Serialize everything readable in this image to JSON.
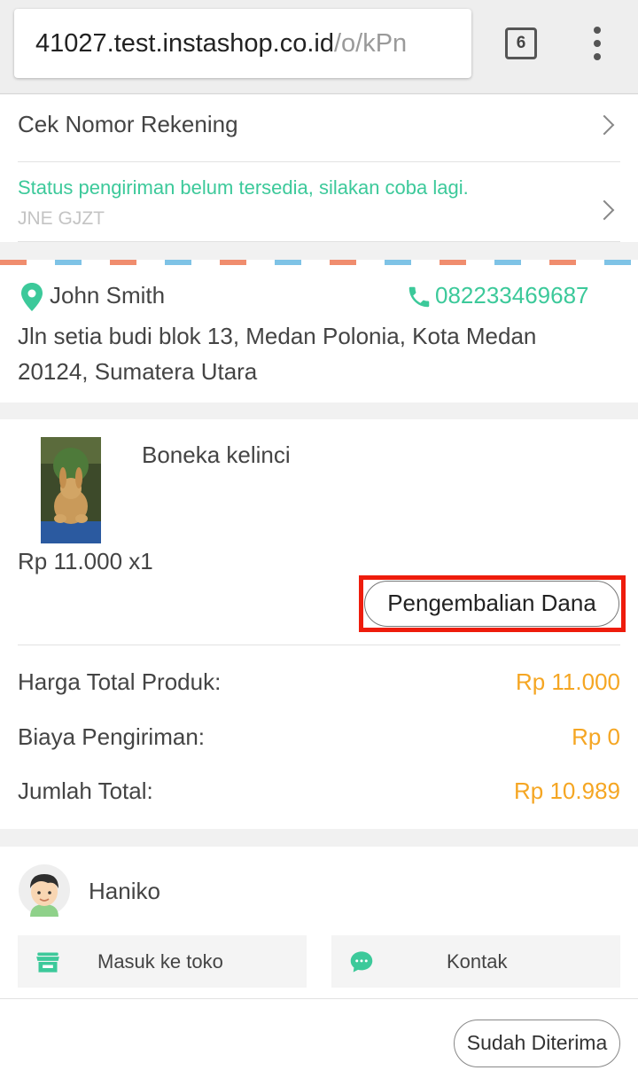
{
  "browser": {
    "url_host": "41027.test.instashop.co.id",
    "url_path": "/o/kPn",
    "tab_count": "6",
    "menu_icon": "more-vert-icon"
  },
  "order": {
    "check_account_label": "Cek Nomor Rekening",
    "shipping_status": "Status pengiriman belum tersedia, silakan coba lagi.",
    "courier": "JNE GJZT"
  },
  "recipient": {
    "name": "John Smith",
    "phone": "082233469687",
    "address": "Jln setia budi blok 13, Medan Polonia, Kota Medan 20124, Sumatera Utara"
  },
  "product": {
    "name": "Boneka kelinci",
    "price_qty": "Rp 11.000 x1",
    "refund_label": "Pengembalian Dana"
  },
  "summary": {
    "rows": [
      {
        "label": "Harga Total Produk:",
        "value": "Rp 11.000"
      },
      {
        "label": "Biaya Pengiriman:",
        "value": "Rp 0"
      },
      {
        "label": "Jumlah Total:",
        "value": "Rp 10.989"
      }
    ]
  },
  "seller": {
    "name": "Haniko",
    "store_button": "Masuk ke toko",
    "contact_button": "Kontak"
  },
  "footer": {
    "received_button": "Sudah Diterima"
  },
  "colors": {
    "accent_green": "#3cc99a",
    "price_orange": "#f5a623",
    "highlight_red": "#ee1c0c"
  }
}
